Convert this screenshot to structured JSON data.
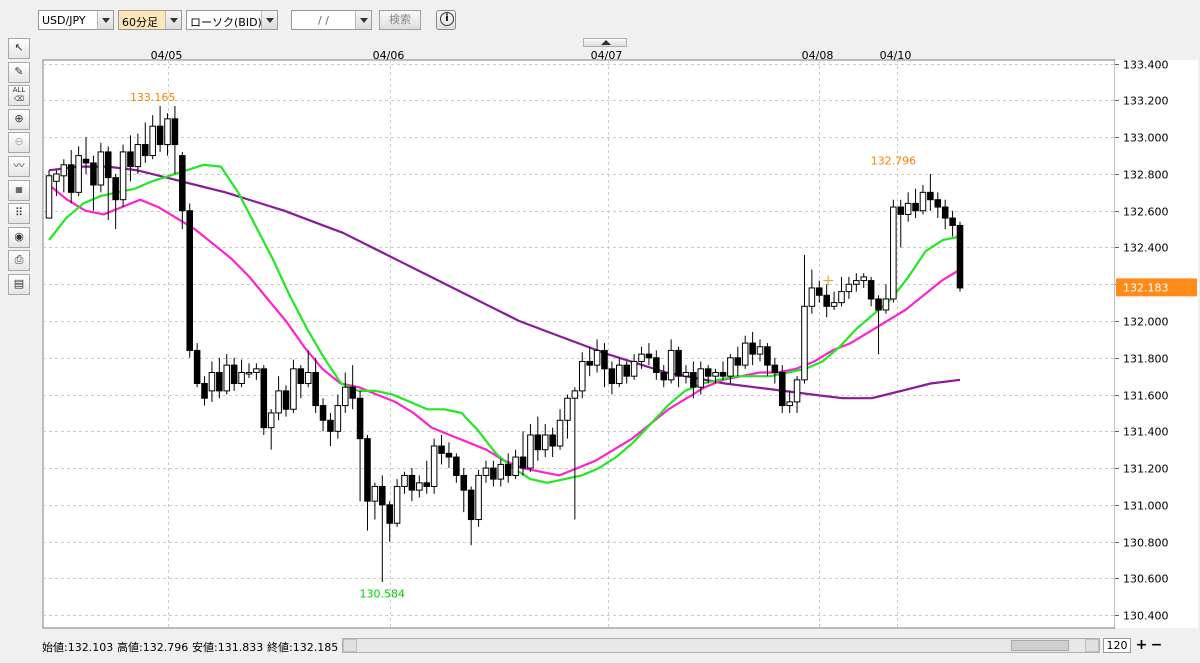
{
  "toolbar": {
    "symbol": "USD/JPY",
    "timeframe": "60分足",
    "chart_type": "ローソク(BID)",
    "date_value": "/ /",
    "search_label": "検索",
    "info_icon": "info-icon"
  },
  "left_tools": [
    "cursor-icon",
    "pencil-icon",
    "eraser-all-icon",
    "zoom-in-icon",
    "zoom-out-icon",
    "indicator-icon",
    "table-icon",
    "dots-icon",
    "eye-icon",
    "print-icon",
    "grid-icon"
  ],
  "chart_data": {
    "type": "candlestick",
    "symbol": "USD/JPY",
    "x_tick_labels": [
      "04/05",
      "04/06",
      "04/07",
      "04/08",
      "04/10"
    ],
    "y_ticks": [
      133.4,
      133.2,
      133.0,
      132.8,
      132.6,
      132.4,
      132.2,
      132.0,
      131.8,
      131.6,
      131.4,
      131.2,
      131.0,
      130.8,
      130.6,
      130.4
    ],
    "y_tick_labels": [
      "133.400",
      "133.200",
      "133.000",
      "132.800",
      "132.600",
      "132.400",
      "132.200",
      "132.000",
      "131.800",
      "131.600",
      "131.400",
      "131.200",
      "131.000",
      "130.800",
      "130.600",
      "130.400"
    ],
    "ylim": [
      130.33,
      133.42
    ],
    "current_price": "132.183",
    "annotations": [
      {
        "label": "133.165",
        "value": 133.165,
        "type": "high",
        "color": "#ff8000"
      },
      {
        "label": "132.796",
        "value": 132.796,
        "type": "high",
        "color": "#ff8000"
      },
      {
        "label": "130.584",
        "value": 130.584,
        "type": "low",
        "color": "#00cc00"
      }
    ],
    "candles": [
      [
        132.56,
        132.79,
        132.56,
        132.82
      ],
      [
        132.76,
        132.8,
        132.68,
        132.82
      ],
      [
        132.79,
        132.85,
        132.7,
        132.88
      ],
      [
        132.85,
        132.7,
        132.64,
        132.93
      ],
      [
        132.7,
        132.9,
        132.68,
        132.95
      ],
      [
        132.88,
        132.86,
        132.8,
        133.0
      ],
      [
        132.86,
        132.74,
        132.6,
        132.9
      ],
      [
        132.74,
        132.92,
        132.7,
        132.97
      ],
      [
        132.92,
        132.78,
        132.55,
        132.95
      ],
      [
        132.78,
        132.66,
        132.5,
        132.8
      ],
      [
        132.66,
        132.92,
        132.62,
        132.96
      ],
      [
        132.92,
        132.84,
        132.76,
        133.01
      ],
      [
        132.84,
        132.96,
        132.8,
        133.02
      ],
      [
        132.96,
        132.9,
        132.86,
        133.08
      ],
      [
        132.9,
        133.06,
        132.88,
        133.12
      ],
      [
        133.06,
        132.96,
        132.92,
        133.17
      ],
      [
        132.96,
        133.1,
        132.9,
        133.13
      ],
      [
        133.1,
        132.96,
        132.8,
        133.17
      ],
      [
        132.9,
        132.6,
        132.5,
        132.92
      ],
      [
        132.6,
        131.84,
        131.8,
        132.64
      ],
      [
        131.84,
        131.66,
        131.64,
        131.88
      ],
      [
        131.66,
        131.58,
        131.54,
        131.7
      ],
      [
        131.62,
        131.72,
        131.56,
        131.78
      ],
      [
        131.72,
        131.62,
        131.58,
        131.8
      ],
      [
        131.62,
        131.76,
        131.6,
        131.82
      ],
      [
        131.76,
        131.66,
        131.62,
        131.8
      ],
      [
        131.66,
        131.72,
        131.64,
        131.79
      ],
      [
        131.72,
        131.72,
        131.69,
        131.77
      ],
      [
        131.72,
        131.74,
        131.68,
        131.77
      ],
      [
        131.74,
        131.42,
        131.38,
        131.76
      ],
      [
        131.42,
        131.5,
        131.3,
        131.52
      ],
      [
        131.5,
        131.62,
        131.46,
        131.7
      ],
      [
        131.62,
        131.52,
        131.48,
        131.65
      ],
      [
        131.52,
        131.74,
        131.5,
        131.79
      ],
      [
        131.74,
        131.66,
        131.58,
        131.76
      ],
      [
        131.66,
        131.72,
        131.64,
        131.84
      ],
      [
        131.72,
        131.54,
        131.5,
        131.8
      ],
      [
        131.54,
        131.46,
        131.4,
        131.58
      ],
      [
        131.46,
        131.4,
        131.32,
        131.5
      ],
      [
        131.4,
        131.54,
        131.36,
        131.6
      ],
      [
        131.54,
        131.64,
        131.5,
        131.72
      ],
      [
        131.64,
        131.58,
        131.52,
        131.76
      ],
      [
        131.58,
        131.36,
        131.02,
        131.62
      ],
      [
        131.36,
        131.02,
        130.86,
        131.38
      ],
      [
        131.02,
        131.1,
        130.92,
        131.12
      ],
      [
        131.1,
        131.0,
        130.58,
        131.16
      ],
      [
        131.0,
        130.9,
        130.8,
        131.02
      ],
      [
        130.9,
        131.1,
        130.88,
        131.14
      ],
      [
        131.1,
        131.16,
        131.06,
        131.18
      ],
      [
        131.16,
        131.08,
        131.02,
        131.2
      ],
      [
        131.08,
        131.12,
        131.04,
        131.16
      ],
      [
        131.12,
        131.1,
        131.06,
        131.24
      ],
      [
        131.1,
        131.32,
        131.06,
        131.36
      ],
      [
        131.32,
        131.28,
        131.22,
        131.38
      ],
      [
        131.28,
        131.26,
        131.2,
        131.34
      ],
      [
        131.26,
        131.16,
        131.12,
        131.28
      ],
      [
        131.16,
        131.08,
        130.96,
        131.2
      ],
      [
        131.08,
        130.92,
        130.78,
        131.1
      ],
      [
        130.92,
        131.16,
        130.88,
        131.19
      ],
      [
        131.16,
        131.2,
        131.12,
        131.24
      ],
      [
        131.2,
        131.14,
        131.1,
        131.24
      ],
      [
        131.14,
        131.22,
        131.1,
        131.25
      ],
      [
        131.22,
        131.16,
        131.12,
        131.28
      ],
      [
        131.16,
        131.26,
        131.14,
        131.3
      ],
      [
        131.26,
        131.2,
        131.16,
        131.4
      ],
      [
        131.2,
        131.38,
        131.18,
        131.44
      ],
      [
        131.38,
        131.3,
        131.24,
        131.48
      ],
      [
        131.3,
        131.38,
        131.26,
        131.44
      ],
      [
        131.38,
        131.32,
        131.26,
        131.42
      ],
      [
        131.32,
        131.46,
        131.3,
        131.52
      ],
      [
        131.46,
        131.58,
        131.36,
        131.6
      ],
      [
        131.58,
        131.62,
        130.92,
        131.64
      ],
      [
        131.62,
        131.78,
        131.58,
        131.83
      ],
      [
        131.78,
        131.76,
        131.7,
        131.86
      ],
      [
        131.76,
        131.84,
        131.72,
        131.9
      ],
      [
        131.84,
        131.74,
        131.64,
        131.88
      ],
      [
        131.74,
        131.66,
        131.6,
        131.78
      ],
      [
        131.66,
        131.76,
        131.64,
        131.8
      ],
      [
        131.76,
        131.7,
        131.66,
        131.78
      ],
      [
        131.7,
        131.78,
        131.68,
        131.82
      ],
      [
        131.78,
        131.82,
        131.74,
        131.86
      ],
      [
        131.82,
        131.8,
        131.76,
        131.88
      ],
      [
        131.8,
        131.72,
        131.68,
        131.84
      ],
      [
        131.72,
        131.68,
        131.64,
        131.76
      ],
      [
        131.68,
        131.84,
        131.66,
        131.9
      ],
      [
        131.84,
        131.7,
        131.64,
        131.86
      ],
      [
        131.7,
        131.72,
        131.66,
        131.76
      ],
      [
        131.72,
        131.64,
        131.58,
        131.78
      ],
      [
        131.64,
        131.74,
        131.6,
        131.78
      ],
      [
        131.74,
        131.7,
        131.66,
        131.76
      ],
      [
        131.7,
        131.72,
        131.66,
        131.74
      ],
      [
        131.72,
        131.7,
        131.68,
        131.78
      ],
      [
        131.7,
        131.8,
        131.66,
        131.82
      ],
      [
        131.8,
        131.76,
        131.7,
        131.86
      ],
      [
        131.76,
        131.88,
        131.74,
        131.92
      ],
      [
        131.88,
        131.82,
        131.76,
        131.94
      ],
      [
        131.82,
        131.86,
        131.78,
        131.9
      ],
      [
        131.86,
        131.76,
        131.7,
        131.88
      ],
      [
        131.76,
        131.72,
        131.66,
        131.8
      ],
      [
        131.72,
        131.54,
        131.5,
        131.76
      ],
      [
        131.54,
        131.56,
        131.5,
        131.62
      ],
      [
        131.56,
        131.68,
        131.5,
        131.7
      ],
      [
        131.68,
        132.08,
        131.66,
        132.36
      ],
      [
        132.08,
        132.18,
        132.04,
        132.28
      ],
      [
        132.18,
        132.14,
        132.1,
        132.22
      ],
      [
        132.14,
        132.08,
        132.02,
        132.2
      ],
      [
        132.08,
        132.1,
        132.06,
        132.16
      ],
      [
        132.1,
        132.16,
        132.08,
        132.24
      ],
      [
        132.16,
        132.2,
        132.12,
        132.24
      ],
      [
        132.2,
        132.22,
        132.16,
        132.26
      ],
      [
        132.22,
        132.24,
        132.18,
        132.26
      ],
      [
        132.22,
        132.12,
        132.08,
        132.24
      ],
      [
        132.12,
        132.06,
        131.82,
        132.14
      ],
      [
        132.06,
        132.12,
        132.04,
        132.2
      ],
      [
        132.12,
        132.62,
        132.1,
        132.66
      ],
      [
        132.62,
        132.58,
        132.4,
        132.66
      ],
      [
        132.58,
        132.64,
        132.54,
        132.7
      ],
      [
        132.64,
        132.6,
        132.56,
        132.72
      ],
      [
        132.6,
        132.7,
        132.58,
        132.74
      ],
      [
        132.7,
        132.66,
        132.6,
        132.8
      ],
      [
        132.66,
        132.62,
        132.56,
        132.7
      ],
      [
        132.62,
        132.56,
        132.5,
        132.66
      ],
      [
        132.56,
        132.52,
        132.46,
        132.6
      ],
      [
        132.52,
        132.18,
        132.16,
        132.54
      ]
    ],
    "series": [
      {
        "name": "",
        "color": "#22e822",
        "values": [
          132.44,
          132.56,
          132.64,
          132.68,
          132.7,
          132.72,
          132.76,
          132.79,
          132.82,
          132.85,
          132.84,
          132.7,
          132.52,
          132.34,
          132.14,
          131.96,
          131.8,
          131.66,
          131.62,
          131.62,
          131.6,
          131.56,
          131.52,
          131.52,
          131.5,
          131.4,
          131.28,
          131.2,
          131.14,
          131.12,
          131.14,
          131.16,
          131.2,
          131.26,
          131.34,
          131.44,
          131.54,
          131.62,
          131.66,
          131.68,
          131.7,
          131.7,
          131.7,
          131.72,
          131.74,
          131.78,
          131.86,
          131.96,
          132.04,
          132.12,
          132.24,
          132.38,
          132.44,
          132.46
        ]
      },
      {
        "name": "",
        "color": "#ff22cc",
        "values": [
          132.74,
          132.66,
          132.6,
          132.58,
          132.62,
          132.66,
          132.62,
          132.56,
          132.5,
          132.42,
          132.34,
          132.24,
          132.12,
          132.0,
          131.86,
          131.74,
          131.66,
          131.64,
          131.6,
          131.56,
          131.5,
          131.42,
          131.38,
          131.34,
          131.3,
          131.24,
          131.2,
          131.18,
          131.16,
          131.2,
          131.24,
          131.3,
          131.36,
          131.44,
          131.52,
          131.58,
          131.64,
          131.68,
          131.7,
          131.72,
          131.72,
          131.74,
          131.78,
          131.84,
          131.88,
          131.94,
          132.0,
          132.06,
          132.14,
          132.22,
          132.28
        ]
      },
      {
        "name": "",
        "color": "#8a1a9a",
        "values": [
          132.82,
          132.84,
          132.84,
          132.82,
          132.78,
          132.74,
          132.7,
          132.65,
          132.6,
          132.54,
          132.48,
          132.4,
          132.32,
          132.24,
          132.16,
          132.08,
          132.0,
          131.94,
          131.88,
          131.82,
          131.77,
          131.72,
          131.69,
          131.66,
          131.64,
          131.62,
          131.6,
          131.58,
          131.58,
          131.62,
          131.66,
          131.68
        ]
      }
    ]
  },
  "status": {
    "open": "始値:132.103",
    "high": "高値:132.796",
    "low": "安値:131.833",
    "close": "終値:132.185",
    "zoom": "120",
    "plus_label": "+",
    "minus_label": "−"
  }
}
